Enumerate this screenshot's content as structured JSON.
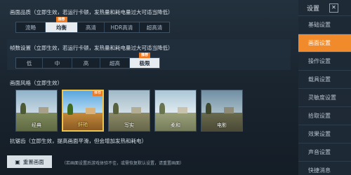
{
  "graphics_quality": {
    "title": "画面品质（立即生效，若运行卡顿，发热量和耗电量过大可适当降低）",
    "options": [
      "流畅",
      "均衡",
      "高清",
      "HDR高清",
      "超高清"
    ],
    "selected": 1,
    "recommended_badge": "推荐"
  },
  "frame_rate": {
    "title": "帧数设置（立即生效，若运行卡顿，发热量和耗电量过大可适当降低）",
    "options": [
      "低",
      "中",
      "高",
      "超高",
      "极限"
    ],
    "selected": 4,
    "recommended_badge": "推荐"
  },
  "graphics_style": {
    "title": "画面风格（立即生效）",
    "styles": [
      "经典",
      "鲜艳",
      "写实",
      "柔和",
      "电影"
    ],
    "selected": 1,
    "recommended_badge": "推荐"
  },
  "anti_aliasing": {
    "title": "抗锯齿（立即生效，提高画面平滑，但会增加发热和耗电）"
  },
  "reset": {
    "button_label": "重置画面",
    "note": "（若画面设置后游戏体验不佳，或需恢复默认设置，请重置画面）"
  },
  "sidebar": {
    "title": "设置",
    "items": [
      "基础设置",
      "画面设置",
      "操作设置",
      "载具设置",
      "灵敏度设置",
      "拾取设置",
      "效果设置",
      "声音设置",
      "快捷消息"
    ],
    "active": 1
  }
}
